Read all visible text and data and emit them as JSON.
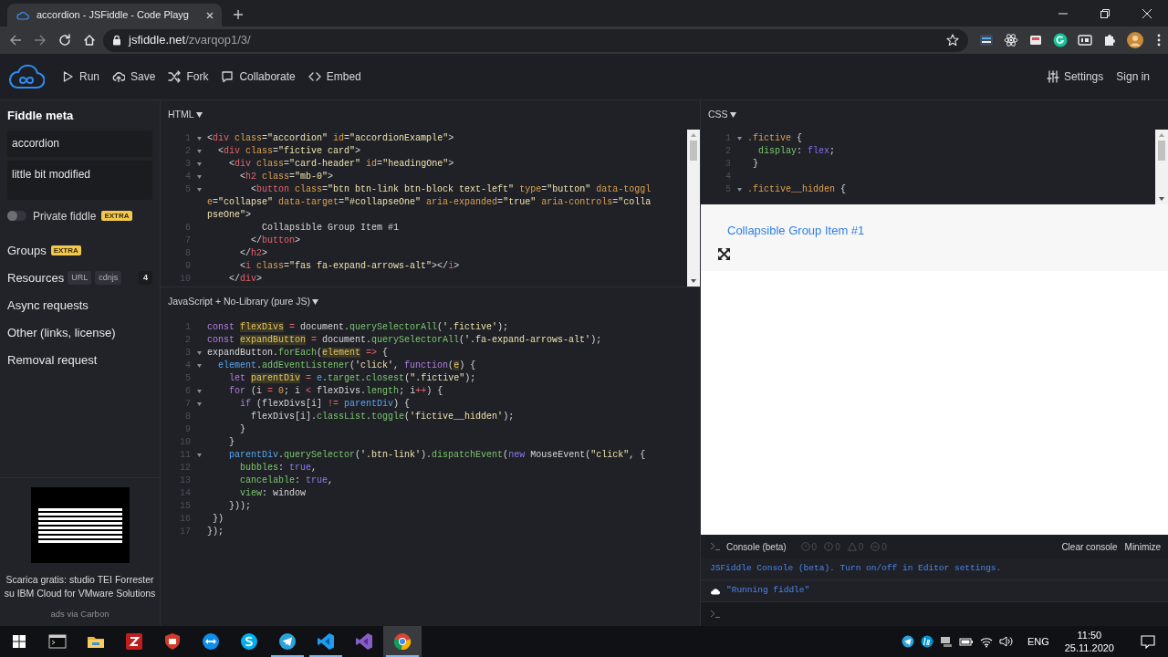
{
  "browser": {
    "tab": {
      "title": "accordion - JSFiddle - Code Playg",
      "selected": true
    },
    "url": {
      "host": "jsfiddle.net",
      "path": "/zvarqop1/3/"
    }
  },
  "toolbar": {
    "actions": [
      {
        "kind": "run",
        "label": "Run"
      },
      {
        "kind": "save",
        "label": "Save"
      },
      {
        "kind": "fork",
        "label": "Fork"
      },
      {
        "kind": "collaborate",
        "label": "Collaborate"
      },
      {
        "kind": "embed",
        "label": "Embed"
      }
    ],
    "settings": "Settings",
    "sign_in": "Sign in"
  },
  "sidebar": {
    "heading": "Fiddle meta",
    "title_value": "accordion",
    "description_value": "little bit modified",
    "private": {
      "label": "Private fiddle",
      "on": false,
      "badge": "EXTRA"
    },
    "items": [
      {
        "label": "Groups",
        "badges": [
          {
            "kind": "extra",
            "text": "EXTRA"
          }
        ]
      },
      {
        "label": "Resources",
        "badges": [
          {
            "kind": "tag",
            "text": "URL"
          },
          {
            "kind": "tag",
            "text": "cdnjs"
          }
        ],
        "count": "4"
      },
      {
        "label": "Async requests"
      },
      {
        "label": "Other (links, license)"
      },
      {
        "label": "Removal request"
      }
    ],
    "ad": {
      "text": "Scarica gratis: studio TEI Forrester su IBM Cloud for VMware Solutions",
      "credit": "ads via Carbon"
    }
  },
  "html_panel": {
    "title": "HTML",
    "lines": [
      {
        "n": "1",
        "fold": true,
        "tokens": [
          {
            "kind": "plain",
            "text": "<"
          },
          {
            "kind": "tag",
            "text": "div"
          },
          {
            "kind": "attr",
            "text": " class"
          },
          {
            "kind": "plain",
            "text": "="
          },
          {
            "kind": "string",
            "text": "\"accordion\""
          },
          {
            "kind": "attr",
            "text": " id"
          },
          {
            "kind": "plain",
            "text": "="
          },
          {
            "kind": "string",
            "text": "\"accordionExample\""
          },
          {
            "kind": "plain",
            "text": ">"
          }
        ]
      },
      {
        "n": "2",
        "fold": true,
        "tokens": [
          {
            "kind": "plain",
            "text": "  <"
          },
          {
            "kind": "tag",
            "text": "div"
          },
          {
            "kind": "attr",
            "text": " class"
          },
          {
            "kind": "plain",
            "text": "="
          },
          {
            "kind": "string",
            "text": "\"fictive card\""
          },
          {
            "kind": "plain",
            "text": ">"
          }
        ]
      },
      {
        "n": "3",
        "fold": true,
        "tokens": [
          {
            "kind": "plain",
            "text": "    <"
          },
          {
            "kind": "tag",
            "text": "div"
          },
          {
            "kind": "attr",
            "text": " class"
          },
          {
            "kind": "plain",
            "text": "="
          },
          {
            "kind": "string",
            "text": "\"card-header\""
          },
          {
            "kind": "attr",
            "text": " id"
          },
          {
            "kind": "plain",
            "text": "="
          },
          {
            "kind": "string",
            "text": "\"headingOne\""
          },
          {
            "kind": "plain",
            "text": ">"
          }
        ]
      },
      {
        "n": "4",
        "fold": true,
        "tokens": [
          {
            "kind": "plain",
            "text": "      <"
          },
          {
            "kind": "tag",
            "text": "h2"
          },
          {
            "kind": "attr",
            "text": " class"
          },
          {
            "kind": "plain",
            "text": "="
          },
          {
            "kind": "string",
            "text": "\"mb-0\""
          },
          {
            "kind": "plain",
            "text": ">"
          }
        ]
      },
      {
        "n": "5",
        "fold": true,
        "tokens": [
          {
            "kind": "plain",
            "text": "        <"
          },
          {
            "kind": "tag",
            "text": "button"
          },
          {
            "kind": "attr",
            "text": " class"
          },
          {
            "kind": "plain",
            "text": "="
          },
          {
            "kind": "string",
            "text": "\"btn btn-link btn-block text-left\""
          },
          {
            "kind": "attr",
            "text": " type"
          },
          {
            "kind": "plain",
            "text": "="
          },
          {
            "kind": "string",
            "text": "\"button\""
          },
          {
            "kind": "attr",
            "text": " data-toggle"
          },
          {
            "kind": "plain",
            "text": "="
          },
          {
            "kind": "string",
            "text": "\"collapse\""
          },
          {
            "kind": "attr",
            "text": " data-target"
          },
          {
            "kind": "plain",
            "text": "="
          },
          {
            "kind": "string",
            "text": "\"#collapseOne\""
          },
          {
            "kind": "attr",
            "text": " aria-expanded"
          },
          {
            "kind": "plain",
            "text": "="
          },
          {
            "kind": "string",
            "text": "\"true\""
          },
          {
            "kind": "attr",
            "text": " aria-controls"
          },
          {
            "kind": "plain",
            "text": "="
          },
          {
            "kind": "string",
            "text": "\"collapseOne\""
          },
          {
            "kind": "plain",
            "text": ">"
          }
        ]
      },
      {
        "n": "6",
        "fold": false,
        "tokens": [
          {
            "kind": "plain",
            "text": "          Collapsible Group Item #1"
          }
        ]
      },
      {
        "n": "7",
        "fold": false,
        "tokens": [
          {
            "kind": "plain",
            "text": "        </"
          },
          {
            "kind": "tag",
            "text": "button"
          },
          {
            "kind": "plain",
            "text": ">"
          }
        ]
      },
      {
        "n": "8",
        "fold": false,
        "tokens": [
          {
            "kind": "plain",
            "text": "      </"
          },
          {
            "kind": "tag",
            "text": "h2"
          },
          {
            "kind": "plain",
            "text": ">"
          }
        ]
      },
      {
        "n": "9",
        "fold": false,
        "tokens": [
          {
            "kind": "plain",
            "text": "      <"
          },
          {
            "kind": "tag",
            "text": "i"
          },
          {
            "kind": "attr",
            "text": " class"
          },
          {
            "kind": "plain",
            "text": "="
          },
          {
            "kind": "string",
            "text": "\"fas fa-expand-arrows-alt\""
          },
          {
            "kind": "plain",
            "text": "></"
          },
          {
            "kind": "tag",
            "text": "i"
          },
          {
            "kind": "plain",
            "text": ">"
          }
        ]
      },
      {
        "n": "10",
        "fold": false,
        "tokens": [
          {
            "kind": "plain",
            "text": "    </"
          },
          {
            "kind": "tag",
            "text": "div"
          },
          {
            "kind": "plain",
            "text": ">"
          }
        ]
      }
    ]
  },
  "js_panel": {
    "title": "JavaScript + No-Library (pure JS)",
    "lines": [
      {
        "n": "1",
        "fold": false,
        "tokens": [
          {
            "kind": "keyword",
            "text": "const "
          },
          {
            "kind": "def",
            "text": "flexDivs"
          },
          {
            "kind": "op",
            "text": " ="
          },
          {
            "kind": "plain",
            "text": " document."
          },
          {
            "kind": "prop",
            "text": "querySelectorAll"
          },
          {
            "kind": "plain",
            "text": "("
          },
          {
            "kind": "string",
            "text": "'.fictive'"
          },
          {
            "kind": "plain",
            "text": ");"
          }
        ]
      },
      {
        "n": "2",
        "fold": false,
        "tokens": [
          {
            "kind": "keyword",
            "text": "const "
          },
          {
            "kind": "def",
            "text": "expandButton"
          },
          {
            "kind": "op",
            "text": " ="
          },
          {
            "kind": "plain",
            "text": " document."
          },
          {
            "kind": "prop",
            "text": "querySelectorAll"
          },
          {
            "kind": "plain",
            "text": "("
          },
          {
            "kind": "string",
            "text": "'.fa-expand-arrows-alt'"
          },
          {
            "kind": "plain",
            "text": ");"
          }
        ]
      },
      {
        "n": "3",
        "fold": true,
        "tokens": [
          {
            "kind": "plain",
            "text": "expandButton."
          },
          {
            "kind": "prop",
            "text": "forEach"
          },
          {
            "kind": "plain",
            "text": "("
          },
          {
            "kind": "def",
            "text": "element"
          },
          {
            "kind": "op",
            "text": " =>"
          },
          {
            "kind": "plain",
            "text": " {"
          }
        ]
      },
      {
        "n": "4",
        "fold": true,
        "tokens": [
          {
            "kind": "var",
            "text": "  element"
          },
          {
            "kind": "plain",
            "text": "."
          },
          {
            "kind": "prop",
            "text": "addEventListener"
          },
          {
            "kind": "plain",
            "text": "("
          },
          {
            "kind": "string",
            "text": "'click'"
          },
          {
            "kind": "plain",
            "text": ", "
          },
          {
            "kind": "keyword",
            "text": "function"
          },
          {
            "kind": "plain",
            "text": "("
          },
          {
            "kind": "def",
            "text": "e"
          },
          {
            "kind": "plain",
            "text": ") {"
          }
        ]
      },
      {
        "n": "5",
        "fold": false,
        "tokens": [
          {
            "kind": "keyword",
            "text": "    let "
          },
          {
            "kind": "def",
            "text": "parentDiv"
          },
          {
            "kind": "op",
            "text": " ="
          },
          {
            "kind": "var",
            "text": " e"
          },
          {
            "kind": "plain",
            "text": "."
          },
          {
            "kind": "prop",
            "text": "target"
          },
          {
            "kind": "plain",
            "text": "."
          },
          {
            "kind": "prop",
            "text": "closest"
          },
          {
            "kind": "plain",
            "text": "("
          },
          {
            "kind": "string",
            "text": "\".fictive\""
          },
          {
            "kind": "plain",
            "text": ");"
          }
        ]
      },
      {
        "n": "6",
        "fold": true,
        "tokens": [
          {
            "kind": "keyword",
            "text": "    for"
          },
          {
            "kind": "plain",
            "text": " (i "
          },
          {
            "kind": "op",
            "text": "="
          },
          {
            "kind": "num",
            "text": " 0"
          },
          {
            "kind": "plain",
            "text": "; i "
          },
          {
            "kind": "op",
            "text": "<"
          },
          {
            "kind": "plain",
            "text": " flexDivs."
          },
          {
            "kind": "prop",
            "text": "length"
          },
          {
            "kind": "plain",
            "text": "; i"
          },
          {
            "kind": "op",
            "text": "++"
          },
          {
            "kind": "plain",
            "text": ") {"
          }
        ]
      },
      {
        "n": "7",
        "fold": true,
        "tokens": [
          {
            "kind": "keyword",
            "text": "      if"
          },
          {
            "kind": "plain",
            "text": " (flexDivs[i] "
          },
          {
            "kind": "op",
            "text": "!="
          },
          {
            "kind": "var",
            "text": " parentDiv"
          },
          {
            "kind": "plain",
            "text": ") {"
          }
        ]
      },
      {
        "n": "8",
        "fold": false,
        "tokens": [
          {
            "kind": "plain",
            "text": "        flexDivs[i]."
          },
          {
            "kind": "prop",
            "text": "classList"
          },
          {
            "kind": "plain",
            "text": "."
          },
          {
            "kind": "prop",
            "text": "toggle"
          },
          {
            "kind": "plain",
            "text": "("
          },
          {
            "kind": "string",
            "text": "'fictive__hidden'"
          },
          {
            "kind": "plain",
            "text": ");"
          }
        ]
      },
      {
        "n": "9",
        "fold": false,
        "tokens": [
          {
            "kind": "plain",
            "text": "      }"
          }
        ]
      },
      {
        "n": "10",
        "fold": false,
        "tokens": [
          {
            "kind": "plain",
            "text": "    }"
          }
        ]
      },
      {
        "n": "11",
        "fold": true,
        "tokens": [
          {
            "kind": "var",
            "text": "    parentDiv"
          },
          {
            "kind": "plain",
            "text": "."
          },
          {
            "kind": "prop",
            "text": "querySelector"
          },
          {
            "kind": "plain",
            "text": "("
          },
          {
            "kind": "string",
            "text": "'.btn-link'"
          },
          {
            "kind": "plain",
            "text": ")."
          },
          {
            "kind": "prop",
            "text": "dispatchEvent"
          },
          {
            "kind": "plain",
            "text": "("
          },
          {
            "kind": "atom",
            "text": "new"
          },
          {
            "kind": "plain",
            "text": " MouseEvent("
          },
          {
            "kind": "string",
            "text": "\"click\""
          },
          {
            "kind": "plain",
            "text": ", {"
          }
        ]
      },
      {
        "n": "12",
        "fold": false,
        "tokens": [
          {
            "kind": "prop",
            "text": "      bubbles"
          },
          {
            "kind": "plain",
            "text": ": "
          },
          {
            "kind": "atom",
            "text": "true"
          },
          {
            "kind": "plain",
            "text": ","
          }
        ]
      },
      {
        "n": "13",
        "fold": false,
        "tokens": [
          {
            "kind": "prop",
            "text": "      cancelable"
          },
          {
            "kind": "plain",
            "text": ": "
          },
          {
            "kind": "atom",
            "text": "true"
          },
          {
            "kind": "plain",
            "text": ","
          }
        ]
      },
      {
        "n": "14",
        "fold": false,
        "tokens": [
          {
            "kind": "prop",
            "text": "      view"
          },
          {
            "kind": "plain",
            "text": ": window"
          }
        ]
      },
      {
        "n": "15",
        "fold": false,
        "tokens": [
          {
            "kind": "plain",
            "text": "    }));"
          }
        ]
      },
      {
        "n": "16",
        "fold": false,
        "tokens": [
          {
            "kind": "plain",
            "text": " })"
          }
        ]
      },
      {
        "n": "17",
        "fold": false,
        "tokens": [
          {
            "kind": "plain",
            "text": "});"
          }
        ]
      }
    ]
  },
  "css_panel": {
    "title": "CSS",
    "lines": [
      {
        "n": "1",
        "fold": true,
        "tokens": [
          {
            "kind": "selector",
            "text": ".fictive"
          },
          {
            "kind": "plain",
            "text": " {"
          }
        ]
      },
      {
        "n": "2",
        "fold": false,
        "tokens": [
          {
            "kind": "cssprop",
            "text": "  display"
          },
          {
            "kind": "plain",
            "text": ": "
          },
          {
            "kind": "cssval",
            "text": "flex"
          },
          {
            "kind": "plain",
            "text": ";"
          }
        ]
      },
      {
        "n": "3",
        "fold": false,
        "tokens": [
          {
            "kind": "plain",
            "text": " }"
          }
        ]
      },
      {
        "n": "4",
        "fold": false
      },
      {
        "n": "5",
        "fold": true,
        "tokens": [
          {
            "kind": "selector",
            "text": ".fictive__hidden"
          },
          {
            "kind": "plain",
            "text": " {"
          }
        ]
      }
    ]
  },
  "result": {
    "link": "Collapsible Group Item #1"
  },
  "console": {
    "title": "Console (beta)",
    "counters": [
      {
        "kind": "log",
        "count": "0"
      },
      {
        "kind": "info",
        "count": "0"
      },
      {
        "kind": "warning",
        "count": "0"
      },
      {
        "kind": "error",
        "count": "0"
      }
    ],
    "actions": [
      "Clear console",
      "Minimize"
    ],
    "messages": [
      {
        "kind": "system",
        "text": "JSFiddle Console (beta). Turn on/off in Editor settings."
      },
      {
        "kind": "log",
        "text": "\"Running fiddle\""
      }
    ]
  },
  "taskbar": {
    "apps": [
      {
        "kind": "terminal",
        "open": false,
        "selected": false
      },
      {
        "kind": "folder",
        "open": false,
        "selected": false
      },
      {
        "kind": "filezilla",
        "open": false,
        "selected": false
      },
      {
        "kind": "shield",
        "open": false,
        "selected": false
      },
      {
        "kind": "teamviewer",
        "open": false,
        "selected": false
      },
      {
        "kind": "skype",
        "open": false,
        "selected": false
      },
      {
        "kind": "telegram",
        "open": true,
        "selected": false
      },
      {
        "kind": "vscode",
        "open": true,
        "selected": false
      },
      {
        "kind": "visualstudio",
        "open": false,
        "selected": false
      },
      {
        "kind": "chrome",
        "open": true,
        "selected": true
      }
    ],
    "language": "ENG",
    "time": "11:50",
    "date": "25.11.2020"
  }
}
